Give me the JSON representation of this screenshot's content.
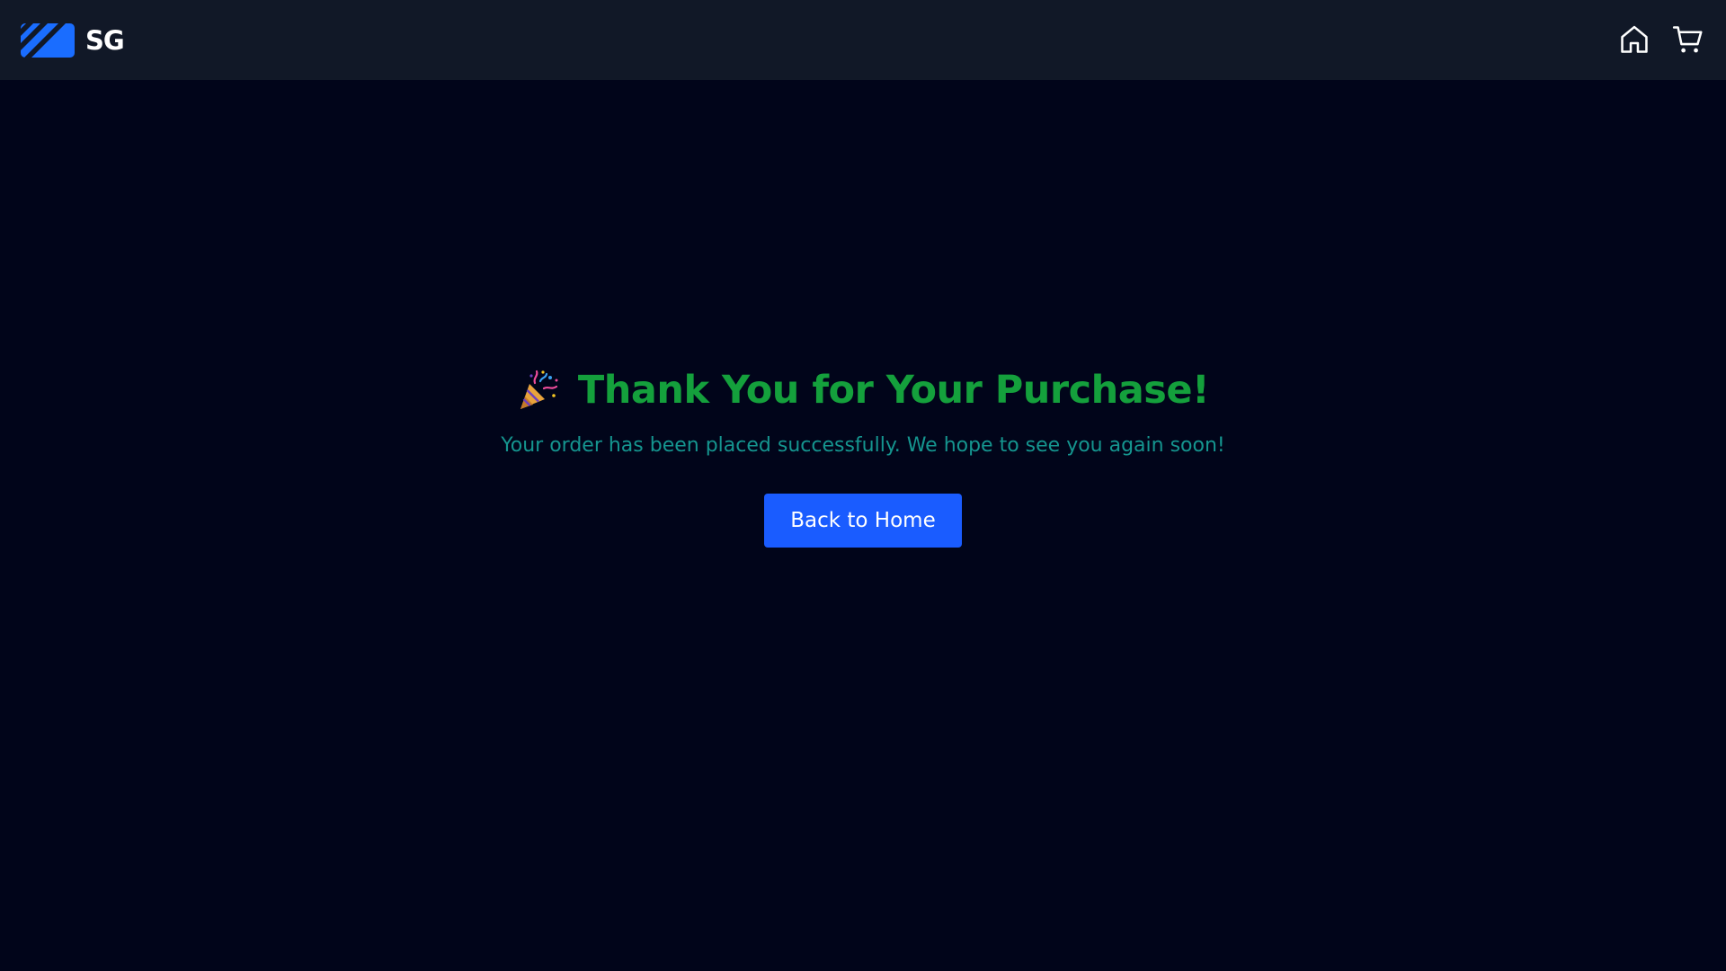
{
  "header": {
    "logo_text": "SG",
    "logo_icon": "sg-logo-stripes",
    "nav_icons": [
      "home-icon",
      "cart-icon"
    ]
  },
  "main": {
    "headline_emoji": "party-popper-icon",
    "headline": "Thank You for Your Purchase!",
    "subtitle": "Your order has been placed successfully. We hope to see you again soon!",
    "back_button_label": "Back to Home"
  },
  "colors": {
    "page_background": "#01051a",
    "header_background": "#111827",
    "headline": "#14a03c",
    "subtitle": "#15958f",
    "button_background": "#1a5cff",
    "logo_accent": "#1a6dff"
  }
}
